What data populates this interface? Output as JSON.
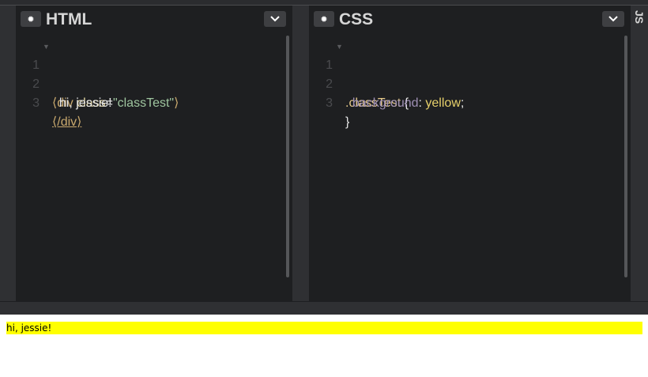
{
  "html_panel": {
    "title": "HTML",
    "lines": [
      {
        "n": "1",
        "tag_open": "⟨div ",
        "attr": "class",
        "eq": "=",
        "str": "\"classTest\"",
        "tag_close": "⟩"
      },
      {
        "n": "2",
        "text": "  hi, jessie!"
      },
      {
        "n": "3",
        "end_tag": "⟨/div⟩"
      }
    ]
  },
  "css_panel": {
    "title": "CSS",
    "lines": [
      {
        "n": "1",
        "selector": ".classTest",
        "brace": " {"
      },
      {
        "n": "2",
        "prop": "  background",
        "colon": ": ",
        "value": "yellow",
        "semi": ";"
      },
      {
        "n": "3",
        "close": "}"
      }
    ]
  },
  "js_panel": {
    "title": "JS"
  },
  "preview": {
    "text": "hi, jessie!",
    "background": "#ffff00"
  },
  "icons": {
    "settings": "gear-icon",
    "collapse": "chevron-down-icon"
  }
}
